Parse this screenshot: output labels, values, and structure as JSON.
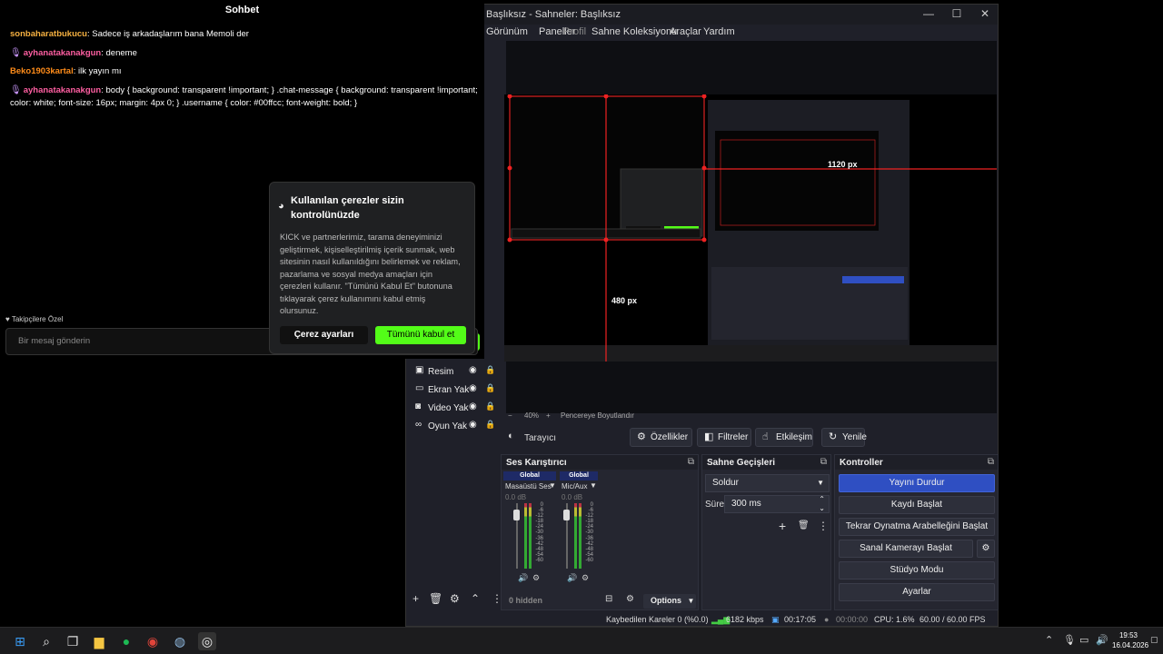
{
  "chat": {
    "title": "Sohbet",
    "messages": [
      {
        "user": "sonbaharatbukucu",
        "text": ": Sadece iş arkadaşlarım bana Memoli der",
        "color": "#f5b041"
      },
      {
        "user": "ayhanatakanakgun",
        "text": ": deneme",
        "color": "#ff5fa2"
      },
      {
        "user": "Beko1903kartal",
        "text": ": ilk yayın mı",
        "color": "#ff8c1a"
      },
      {
        "user": "ayhanatakanakgun",
        "text": ": body { background: transparent !important; } .chat-message { background: transparent !important; color: white; font-size: 16px; margin: 4px 0; } .username { color: #00ffcc; font-weight: bold; }",
        "color": "#ff5fa2"
      }
    ],
    "followers_label": "Takipçilere Özel",
    "input_placeholder": "Bir mesaj gönderin"
  },
  "cookie": {
    "title": "Kullanılan çerezler sizin kontrolünüzde",
    "body": "KICK ve partnerlerimiz, tarama deneyiminizi geliştirmek, kişiselleştirilmiş içerik sunmak, web sitesinin nasıl kullanıldığını belirlemek ve reklam, pazarlama ve sosyal medya amaçları için çerezleri kullanır. \"Tümünü Kabul Et\" butonuna tıklayarak çerez kullanımını kabul etmiş olursunuz.",
    "settings_label": "Çerez ayarları",
    "accept_label": "Tümünü kabul et"
  },
  "obs": {
    "title": "Başlıksız - Sahneler: Başlıksız",
    "menu": [
      "Görünüm",
      "Paneller",
      "Profil",
      "Sahne Koleksiyonu",
      "Araçlar",
      "Yardım"
    ],
    "preview": {
      "width_label": "1120 px",
      "height_label": "480 px"
    },
    "zoom": {
      "minus": "−",
      "level": "40%",
      "plus": "+",
      "mode": "Pencereye Boyutlandır"
    },
    "source_toolbar": {
      "source_name": "Tarayıcı",
      "properties": "Özellikler",
      "filters": "Filtreler",
      "interact": "Etkileşim",
      "refresh": "Yenile"
    },
    "sources": [
      {
        "name": "Resim",
        "icon": "image-icon"
      },
      {
        "name": "Ekran Yak",
        "icon": "monitor-icon"
      },
      {
        "name": "Video Yak",
        "icon": "camera-icon"
      },
      {
        "name": "Oyun Yak",
        "icon": "gamepad-icon"
      }
    ],
    "mixer": {
      "title": "Ses Karıştırıcı",
      "channels": [
        {
          "scope": "Global",
          "name": "Masaüstü Ses",
          "db": "0.0 dB"
        },
        {
          "scope": "Global",
          "name": "Mic/Aux",
          "db": "0.0 dB"
        }
      ],
      "scale": [
        "0",
        "-6",
        "-12",
        "-18",
        "-24",
        "-30",
        "-36",
        "-42",
        "-48",
        "-54",
        "-60"
      ],
      "hidden": "0 hidden",
      "options": "Options"
    },
    "transitions": {
      "title": "Sahne Geçişleri",
      "selected": "Soldur",
      "duration_label": "Süre",
      "duration_value": "300 ms"
    },
    "controls": {
      "title": "Kontroller",
      "buttons": [
        "Yayını Durdur",
        "Kaydı Başlat",
        "Tekrar Oynatma Arabelleğini Başlat",
        "Sanal Kamerayı Başlat",
        "Stüdyo Modu",
        "Ayarlar"
      ]
    },
    "status": {
      "dropped": "Kaybedilen Kareler 0 (%0.0)",
      "bitrate": "6182 kbps",
      "stream_time": "00:17:05",
      "rec_time": "00:00:00",
      "cpu": "CPU: 1.6%",
      "fps": "60.00 / 60.00 FPS"
    }
  },
  "taskbar": {
    "time": "19:53",
    "date": "16.04.2026"
  }
}
